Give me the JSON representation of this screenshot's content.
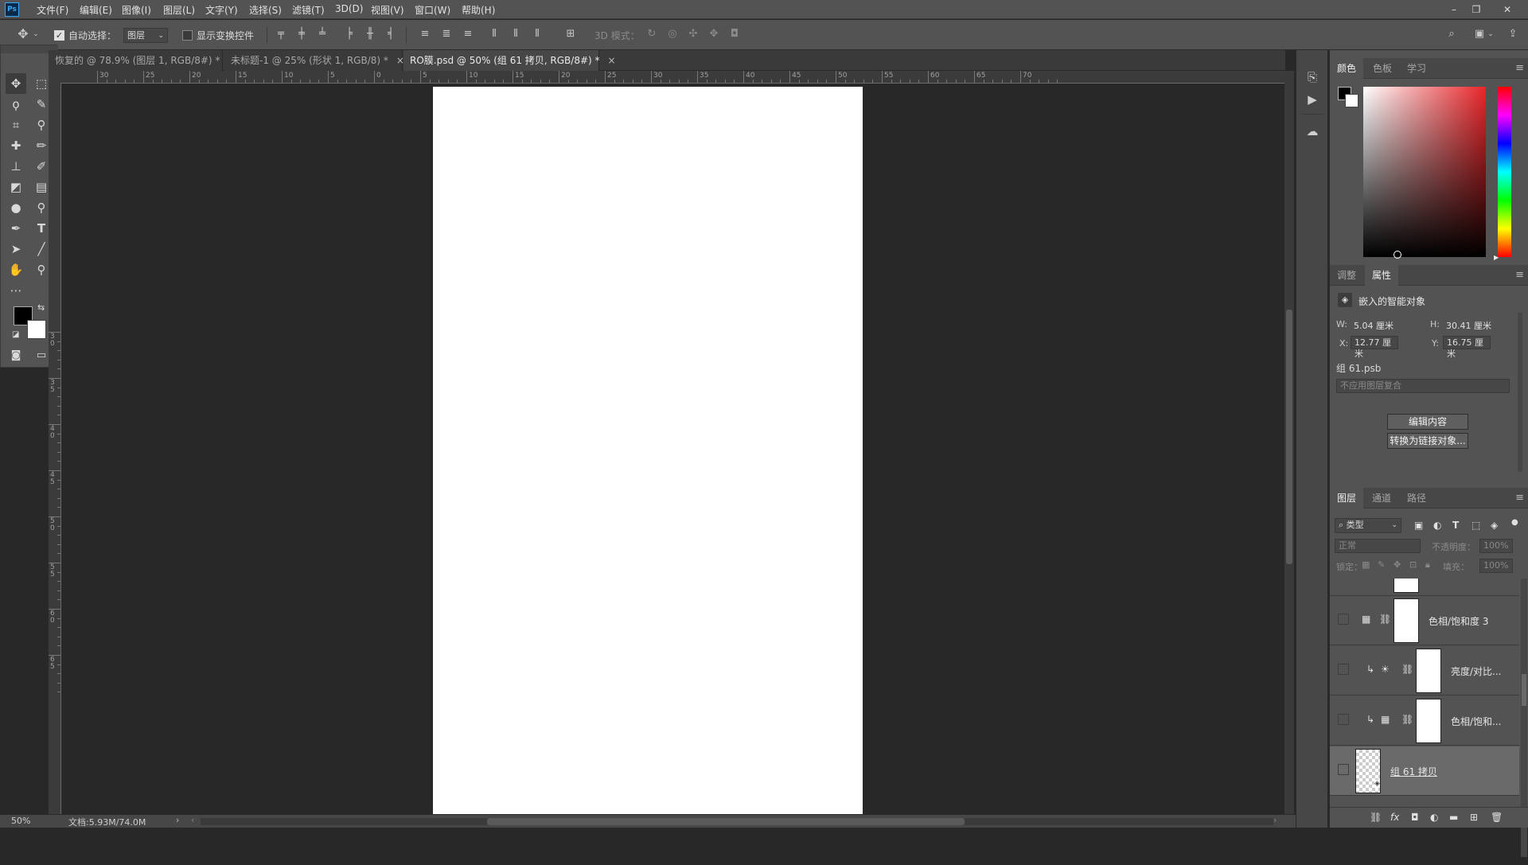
{
  "app": {
    "logo": "Ps"
  },
  "menu": [
    "文件(F)",
    "编辑(E)",
    "图像(I)",
    "图层(L)",
    "文字(Y)",
    "选择(S)",
    "滤镜(T)",
    "3D(D)",
    "视图(V)",
    "窗口(W)",
    "帮助(H)"
  ],
  "window_controls": {
    "minimize": "–",
    "restore": "❐",
    "close": "✕"
  },
  "options": {
    "auto_select_label": "自动选择：",
    "auto_select_checked": true,
    "auto_select_target": "图层",
    "show_transform_label": "显示变换控件",
    "mode_3d_label": "3D 模式："
  },
  "tabs": [
    {
      "label": "恢复的 @ 78.9% (图层 1, RGB/8#) *",
      "close": "×"
    },
    {
      "label": "未标题-1 @ 25% (形状 1, RGB/8) *",
      "close": "×"
    },
    {
      "label": "RO膜.psd @ 50% (组 61 拷贝, RGB/8#) *",
      "close": "×",
      "active": true
    }
  ],
  "ruler": {
    "h_labels": [
      "30",
      "25",
      "20",
      "15",
      "10",
      "5",
      "0",
      "5",
      "10",
      "15",
      "20",
      "25",
      "30",
      "35",
      "40",
      "45",
      "50",
      "55",
      "60",
      "65",
      "70"
    ],
    "v_labels": [
      "3 0",
      "3 5",
      "4 0",
      "4 5",
      "5 0",
      "5 5",
      "6 0",
      "6 5"
    ]
  },
  "status": {
    "zoom": "50%",
    "doc": "文档:5.93M/74.0M"
  },
  "color_panel": {
    "tabs": [
      "颜色",
      "色板",
      "学习"
    ],
    "active": "颜色",
    "hue_color": "#e8262a"
  },
  "properties_panel": {
    "tabs": [
      "调整",
      "属性"
    ],
    "active": "属性",
    "object_type": "嵌入的智能对象",
    "w_label": "W:",
    "w_value": "5.04 厘米",
    "h_label": "H:",
    "h_value": "30.41 厘米",
    "x_label": "X:",
    "x_value": "12.77 厘米",
    "y_label": "Y:",
    "y_value": "16.75 厘米",
    "file_name": "组 61.psb",
    "comp_placeholder": "不应用图层复合",
    "edit_button": "编辑内容",
    "convert_button": "转换为链接对象..."
  },
  "layers_panel": {
    "tabs": [
      "图层",
      "通道",
      "路径"
    ],
    "active": "图层",
    "filter_label": "类型",
    "blend_mode": "正常",
    "opacity_label": "不透明度：",
    "opacity_value": "100%",
    "lock_label": "锁定：",
    "fill_label": "填充：",
    "fill_value": "100%",
    "layers": [
      {
        "name": "色相/饱和度 3",
        "kind": "hue"
      },
      {
        "name": "亮度/对比...",
        "kind": "brightness",
        "clipped": true
      },
      {
        "name": "色相/饱和...",
        "kind": "hue",
        "clipped": true
      },
      {
        "name": "组 61 拷贝",
        "kind": "smart",
        "selected": true
      }
    ]
  }
}
